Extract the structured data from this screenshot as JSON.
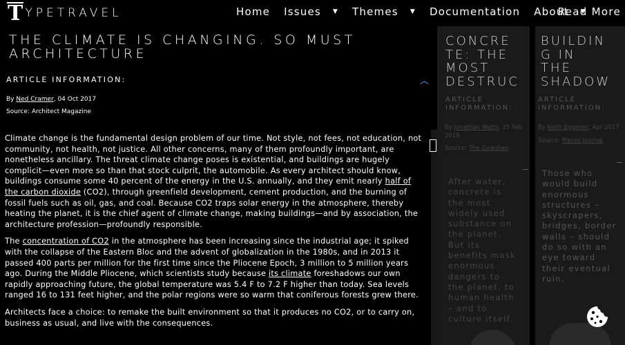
{
  "nav": {
    "logo_letter": "T",
    "logo_text": "YPETRAVEL",
    "items": [
      {
        "label": "Home",
        "dropdown": false
      },
      {
        "label": "Issues",
        "dropdown": true
      },
      {
        "label": "Themes",
        "dropdown": true
      },
      {
        "label": "Documentation",
        "dropdown": false
      },
      {
        "label": "About",
        "dropdown": true
      }
    ],
    "read_more": "Read More"
  },
  "article": {
    "title": "The climate is changing. So must architecture",
    "info_heading": "Article Information:",
    "by_prefix": "By ",
    "author": "Ned Cramer",
    "date": ", 04 Oct 2017",
    "source_prefix": "Source: ",
    "source": "Architect Magazine",
    "p1_a": "Climate change is the fundamental design problem of our time. Not style, not fees, not education, not community, not health, not justice. All other concerns, many of them profoundly important, are nonetheless ancillary. The threat climate change poses is existential, and buildings are hugely complicit—even more so than that stock culprit, the automobile. As every architect should know, buildings consume some 40 percent of the energy in the U.S. annually, and they emit nearly ",
    "p1_link": "half of the carbon dioxide",
    "p1_b": " (CO2), through greenfield development, cement production, and the burning of fossil fuels such as oil, gas, and coal. Because CO2 traps solar energy in the atmosphere, thereby heating the planet, it is the chief agent of climate change, making buildings—and by association, the architecture profession—profoundly responsible.",
    "p2_a": "The ",
    "p2_link1": "concentration of CO2",
    "p2_b": " in the atmosphere has been increasing since the industrial age; it spiked with the collapse of the Eastern Bloc and the advent of globalization in the 1980s, and in 2013 it passed 400 parts per million for the first time since the Pliocene Epoch, 3 million to 5 million years ago. During the Middle Pliocene, which scientists study because ",
    "p2_link2": "its climate",
    "p2_c": " foreshadows our own rapidly approaching future, the global temperature was 5.4 F to 7.2 F higher than today. Sea levels ranged 16 to 131 feet higher, and the polar regions were so warm that coniferous forests grew there.",
    "p3": "Architects face a choice: to remake the built environment so that it produces no CO2, or to carry on, business as usual, and live with the consequences."
  },
  "side_articles": [
    {
      "title": "Concre\nte: the\nmost\ndestruc",
      "info_heading": "Article\nInformation:",
      "by_prefix": "By ",
      "author": "Jonathan Watts",
      "date": ", 25 Feb 2019",
      "source_prefix": "Source: ",
      "source": "The Guardian",
      "body": "After water, concrete is the most widely used substance on the planet. But its benefits mask enormous dangers to the planet, to human health – and to culture itself."
    },
    {
      "title": "Buildin\ng in\nthe\nshadow",
      "info_heading": "Article\nInformation:",
      "by_prefix": "By ",
      "author": "Keith Eggener",
      "date": ", Apr 2017",
      "source_prefix": "Source: ",
      "source": "Places Journal",
      "body": "Those who would build enormous structures – skyscrapers, bridges, border walls – should do so with an eye toward their eventual ruin."
    }
  ]
}
